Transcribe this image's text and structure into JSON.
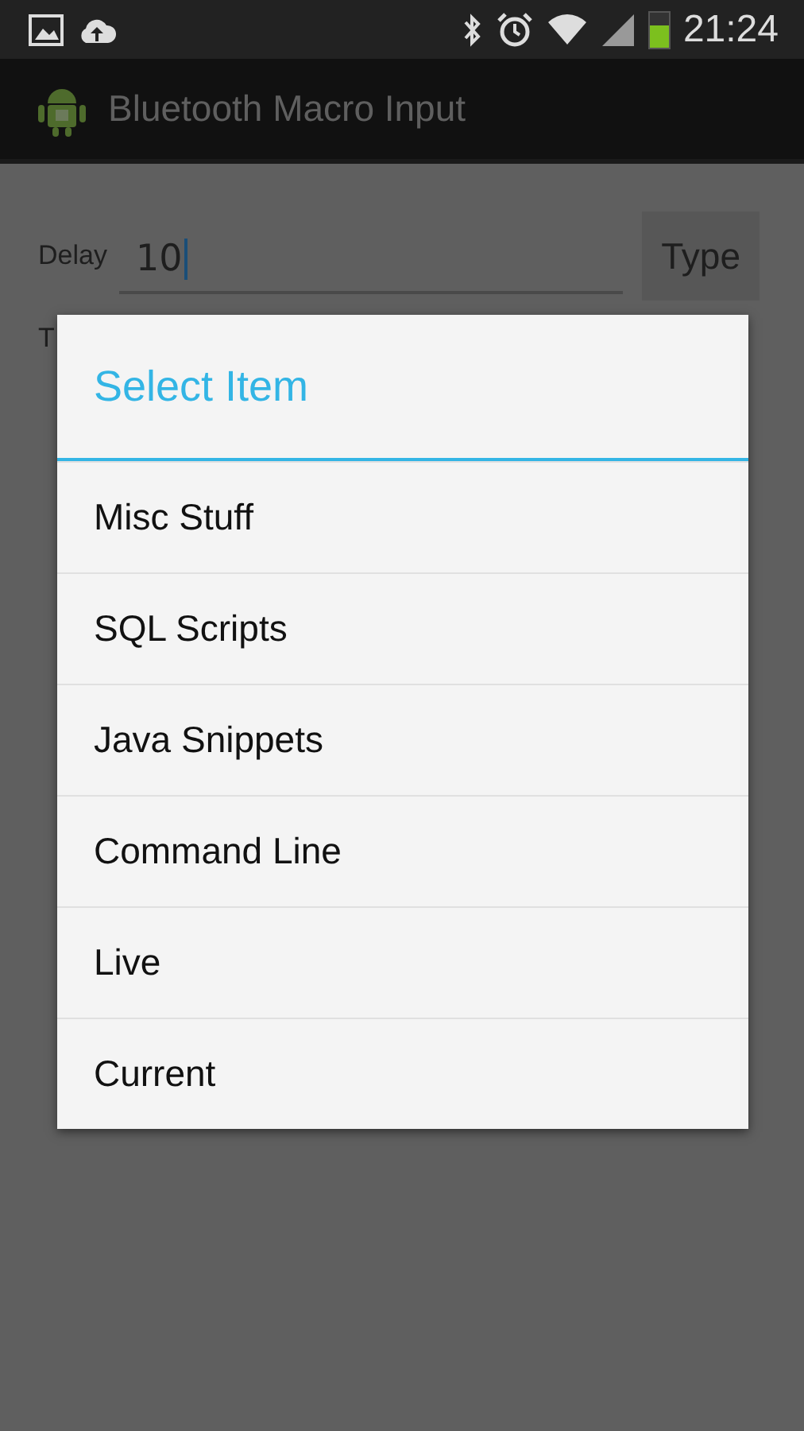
{
  "status_bar": {
    "time": "21:24"
  },
  "app_bar": {
    "title": "Bluetooth Macro Input"
  },
  "form": {
    "delay_label": "Delay",
    "delay_value": "10",
    "type_button": "Type",
    "partial_label": "T"
  },
  "dialog": {
    "title": "Select Item",
    "items": [
      {
        "label": "Misc Stuff"
      },
      {
        "label": "SQL Scripts"
      },
      {
        "label": "Java Snippets"
      },
      {
        "label": "Command Line"
      },
      {
        "label": "Live"
      },
      {
        "label": "Current"
      }
    ]
  }
}
